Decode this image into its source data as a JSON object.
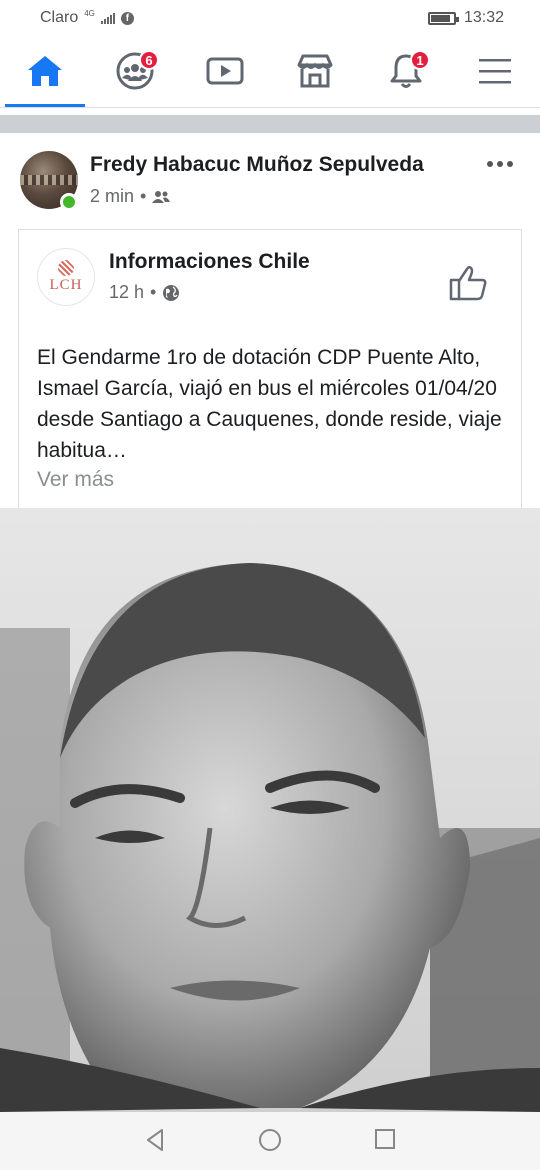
{
  "status_bar": {
    "carrier": "Claro",
    "network": "4G",
    "time": "13:32",
    "battery_level": 0.85
  },
  "nav": {
    "items": [
      {
        "name": "home",
        "icon": "home-icon",
        "active": true
      },
      {
        "name": "groups",
        "icon": "groups-icon",
        "badge": "6"
      },
      {
        "name": "watch",
        "icon": "video-icon"
      },
      {
        "name": "marketplace",
        "icon": "store-icon"
      },
      {
        "name": "notifications",
        "icon": "bell-icon",
        "badge": "1"
      },
      {
        "name": "menu",
        "icon": "hamburger-menu-icon"
      }
    ],
    "accent_color": "#1877f2",
    "badge_color": "#e41e3f"
  },
  "post": {
    "author": "Fredy Habacuc Muñoz Sepulveda",
    "time": "2 min",
    "separator": "•",
    "audience_icon": "friends-icon",
    "online": true
  },
  "shared_post": {
    "page_name": "Informaciones Chile",
    "logo_text": "LCH",
    "time": "12 h",
    "separator": "•",
    "audience_icon": "globe-icon",
    "text": "El Gendarme 1ro de dotación CDP Puente Alto, Ismael García, viajó en bus el miércoles 01/04/20 desde Santiago a Cauquenes, donde reside, viaje habitua…",
    "see_more": "Ver más"
  },
  "system_nav": {
    "icons": [
      "back-icon",
      "home-circle-icon",
      "recents-icon"
    ]
  }
}
